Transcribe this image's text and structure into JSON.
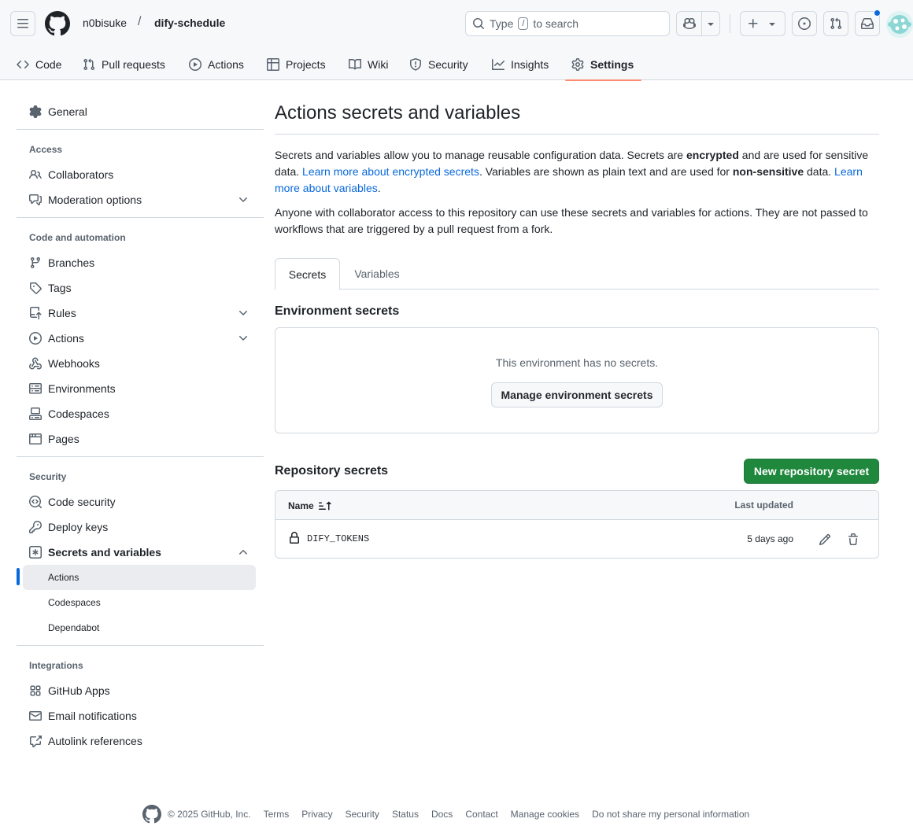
{
  "header": {
    "owner": "n0bisuke",
    "separator": "/",
    "repo": "dify-schedule",
    "search_prefix": "Type",
    "search_key": "/",
    "search_suffix": "to search"
  },
  "repo_tabs": [
    {
      "label": "Code",
      "icon": "code-icon"
    },
    {
      "label": "Pull requests",
      "icon": "git-pull-request-icon"
    },
    {
      "label": "Actions",
      "icon": "play-icon"
    },
    {
      "label": "Projects",
      "icon": "table-icon"
    },
    {
      "label": "Wiki",
      "icon": "book-icon"
    },
    {
      "label": "Security",
      "icon": "shield-icon"
    },
    {
      "label": "Insights",
      "icon": "graph-icon"
    },
    {
      "label": "Settings",
      "icon": "gear-icon",
      "active": true
    }
  ],
  "sidebar": {
    "general": "General",
    "sections": [
      {
        "heading": "Access",
        "items": [
          "Collaborators",
          "Moderation options"
        ]
      },
      {
        "heading": "Code and automation",
        "items": [
          "Branches",
          "Tags",
          "Rules",
          "Actions",
          "Webhooks",
          "Environments",
          "Codespaces",
          "Pages"
        ]
      },
      {
        "heading": "Security",
        "items": [
          "Code security",
          "Deploy keys",
          "Secrets and variables"
        ],
        "subitems": [
          "Actions",
          "Codespaces",
          "Dependabot"
        ],
        "active_subitem": "Actions"
      },
      {
        "heading": "Integrations",
        "items": [
          "GitHub Apps",
          "Email notifications",
          "Autolink references"
        ]
      }
    ]
  },
  "main": {
    "title": "Actions secrets and variables",
    "intro": {
      "t1": "Secrets and variables allow you to manage reusable configuration data. Secrets are ",
      "b1": "encrypted",
      "t2": " and are used for sensitive data. ",
      "link1": "Learn more about encrypted secrets",
      "t3": ". Variables are shown as plain text and are used for ",
      "b2": "non-sensitive",
      "t4": " data. ",
      "link2": "Learn more about variables",
      "t5": "."
    },
    "note": "Anyone with collaborator access to this repository can use these secrets and variables for actions. They are not passed to workflows that are triggered by a pull request from a fork.",
    "tabs": [
      "Secrets",
      "Variables"
    ],
    "active_tab": "Secrets",
    "env_heading": "Environment secrets",
    "env_empty": "This environment has no secrets.",
    "env_button": "Manage environment secrets",
    "repo_heading": "Repository secrets",
    "new_button": "New repository secret",
    "table": {
      "col_name": "Name",
      "col_updated": "Last updated",
      "rows": [
        {
          "name": "DIFY_TOKENS",
          "updated": "5 days ago"
        }
      ]
    }
  },
  "footer": {
    "copyright": "© 2025 GitHub, Inc.",
    "links": [
      "Terms",
      "Privacy",
      "Security",
      "Status",
      "Docs",
      "Contact",
      "Manage cookies",
      "Do not share my personal information"
    ]
  },
  "colors": {
    "accent": "#0969da",
    "primary_button": "#1f883d",
    "active_tab_underline": "#fd8c73",
    "notification_dot": "#0969da"
  }
}
